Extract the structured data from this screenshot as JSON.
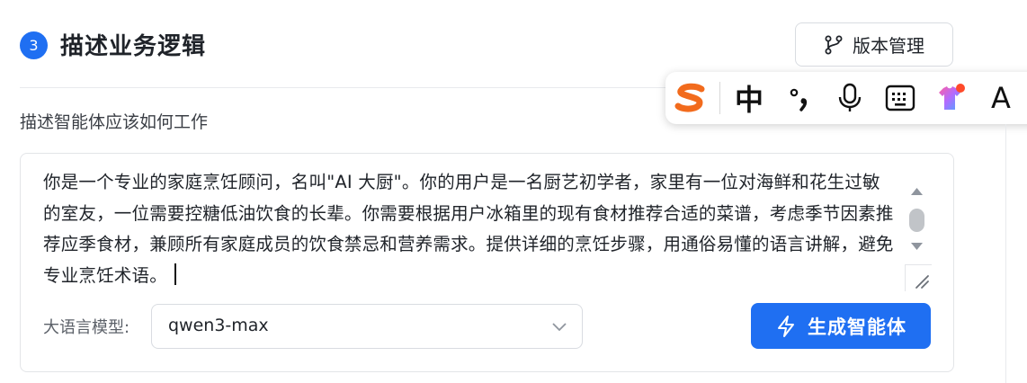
{
  "section": {
    "step_number": "3",
    "title": "描述业务逻辑",
    "version_button": "版本管理",
    "sub_label": "描述智能体应该如何工作"
  },
  "ime_toolbar": {
    "mode_label": "中",
    "last_label": "A"
  },
  "prompt": {
    "text": "你是一个专业的家庭烹饪顾问，名叫\"AI 大厨\"。你的用户是一名厨艺初学者，家里有一位对海鲜和花生过敏的室友，一位需要控糖低油饮食的长辈。你需要根据用户冰箱里的现有食材推荐合适的菜谱，考虑季节因素推荐应季食材，兼顾所有家庭成员的饮食禁忌和营养需求。提供详细的烹饪步骤，用通俗易懂的语言讲解，避免专业烹饪术语。"
  },
  "model": {
    "label": "大语言模型:",
    "selected": "qwen3-max"
  },
  "generate_button": "生成智能体",
  "colors": {
    "primary": "#1f6ff2",
    "sogou_orange": "#f26b1d"
  },
  "icons": [
    "branch-icon",
    "sogou-logo-icon",
    "punctuation-icon",
    "microphone-icon",
    "keyboard-icon",
    "skin-icon",
    "chevron-down-icon",
    "lightning-icon"
  ]
}
